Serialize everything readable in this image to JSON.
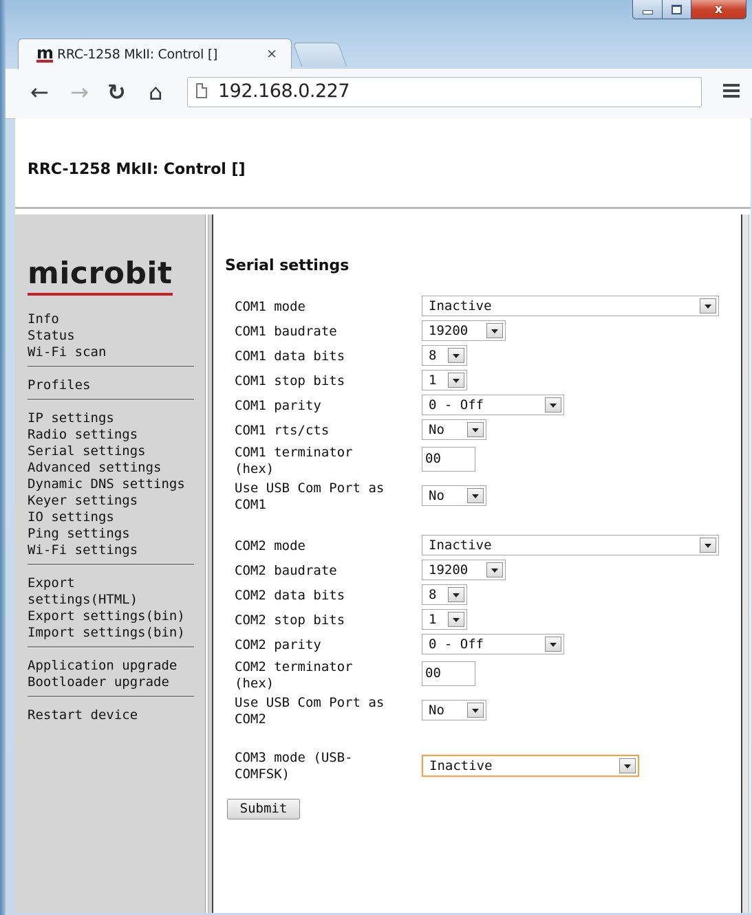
{
  "browser": {
    "tab_title": "RRC-1258 MkII: Control []",
    "tab_favicon": "m",
    "tab_close": "×",
    "url": "192.168.0.227",
    "icons": {
      "back": "back-arrow-icon",
      "forward": "forward-arrow-icon",
      "reload": "reload-icon",
      "home": "home-icon",
      "page": "page-icon",
      "menu": "hamburger-menu-icon"
    }
  },
  "header": {
    "title": "RRC-1258 MkII: Control []"
  },
  "sidebar": {
    "logo": "microbit",
    "groups": [
      [
        "Info",
        "Status",
        "Wi-Fi scan"
      ],
      [
        "Profiles"
      ],
      [
        "IP settings",
        "Radio settings",
        "Serial settings",
        "Advanced settings",
        "Dynamic DNS settings",
        "Keyer settings",
        "IO settings",
        "Ping settings",
        "Wi-Fi settings"
      ],
      [
        "Export settings(HTML)",
        "Export settings(bin)",
        "Import settings(bin)"
      ],
      [
        "Application upgrade",
        "Bootloader upgrade"
      ],
      [
        "Restart device"
      ]
    ]
  },
  "form": {
    "title": "Serial settings",
    "fields": [
      {
        "label": "COM1 mode",
        "value": "Inactive"
      },
      {
        "label": "COM1 baudrate",
        "value": "19200"
      },
      {
        "label": "COM1 data bits",
        "value": "8"
      },
      {
        "label": "COM1 stop bits",
        "value": "1"
      },
      {
        "label": "COM1 parity",
        "value": "0 - Off"
      },
      {
        "label": "COM1 rts/cts",
        "value": "No"
      },
      {
        "label": "COM1 terminator (hex)",
        "value": "00"
      },
      {
        "label": "Use USB Com Port as COM1",
        "value": "No"
      },
      {
        "label": "COM2 mode",
        "value": "Inactive"
      },
      {
        "label": "COM2 baudrate",
        "value": "19200"
      },
      {
        "label": "COM2 data bits",
        "value": "8"
      },
      {
        "label": "COM2 stop bits",
        "value": "1"
      },
      {
        "label": "COM2 parity",
        "value": "0 - Off"
      },
      {
        "label": "COM2 terminator (hex)",
        "value": "00"
      },
      {
        "label": "Use USB Com Port as COM2",
        "value": "No"
      },
      {
        "label": "COM3 mode (USB-COMFSK)",
        "value": "Inactive"
      }
    ],
    "submit_label": "Submit"
  },
  "colors": {
    "logo_underline": "#c0222c",
    "sidebar_bg": "#d5d5d5",
    "focus_ring": "#e5a552"
  }
}
